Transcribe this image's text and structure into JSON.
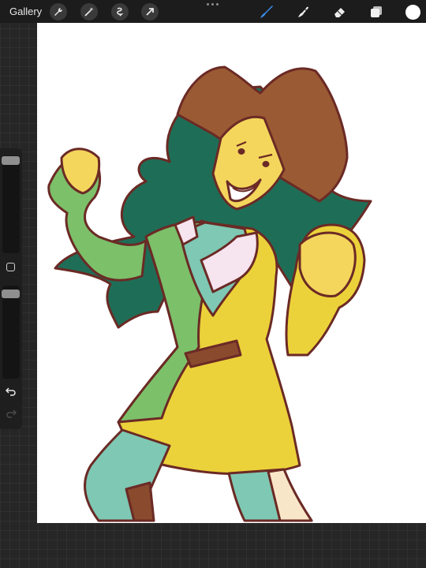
{
  "toolbar": {
    "gallery_label": "Gallery",
    "left_tools": [
      "wrench-icon",
      "magic-wand-icon",
      "selection-icon",
      "transform-arrow-icon"
    ],
    "right_tools": [
      "brush-icon",
      "smudge-icon",
      "eraser-icon",
      "layers-icon",
      "color-swatch"
    ],
    "active_tool": "brush",
    "accent_color": "#3b8ef0",
    "current_color": "#ffffff"
  },
  "sidebar": {
    "brush_size": 0.95,
    "opacity": 0.95,
    "icons": [
      "modify-square-icon",
      "undo-icon",
      "redo-icon"
    ],
    "redo_enabled": false
  },
  "canvas": {
    "background": "#ffffff",
    "palette": {
      "outline": "#6b2a25",
      "hair": "#1e6e57",
      "hat": "#9a5a33",
      "skin": "#f4d65c",
      "coat_green": "#7cc06a",
      "coat_yellow": "#ecd23a",
      "shirt": "#7ec8b4",
      "collar": "#f6e4ef",
      "belt": "#8a4a2e",
      "leg_light": "#f8e6c8"
    }
  }
}
